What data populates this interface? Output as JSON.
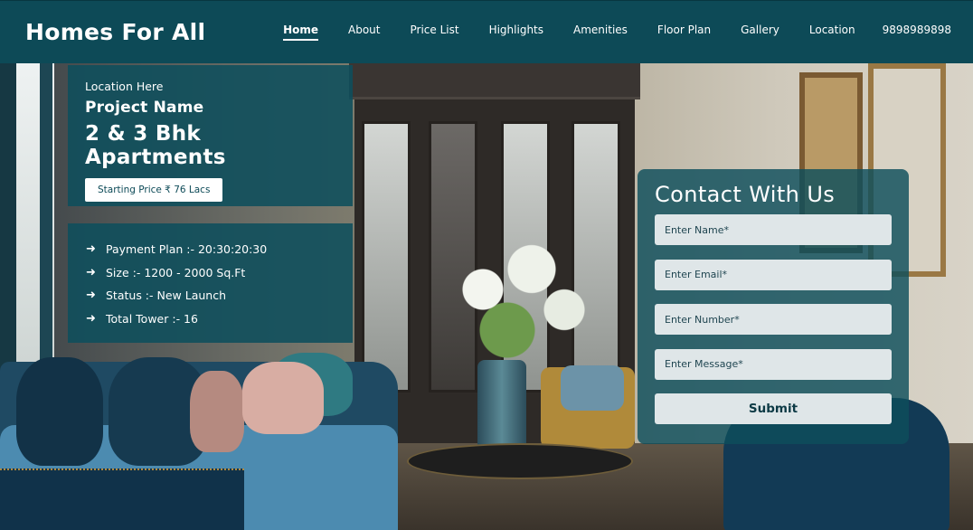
{
  "header": {
    "brand": "Homes For All",
    "nav": [
      "Home",
      "About",
      "Price List",
      "Highlights",
      "Amenities",
      "Floor Plan",
      "Gallery",
      "Location"
    ],
    "phone": "9898989898",
    "active": "Home"
  },
  "hero": {
    "location": "Location Here",
    "project_name": "Project Name",
    "apartment_type": "2 & 3 Bhk Apartments",
    "price_button": "Starting Price ₹ 76 Lacs",
    "features": [
      {
        "icon": "arrow-right-icon",
        "text": "Payment Plan :- 20:30:20:30"
      },
      {
        "icon": "arrow-right-icon",
        "text": "Size :-  1200 - 2000 Sq.Ft"
      },
      {
        "icon": "arrow-right-icon",
        "text": "Status :- New Launch"
      },
      {
        "icon": "arrow-right-icon",
        "text": "Total Tower :- 16"
      }
    ]
  },
  "contact": {
    "title": "Contact With Us",
    "name_placeholder": "Enter Name*",
    "email_placeholder": "Enter Email*",
    "number_placeholder": "Enter Number*",
    "message_placeholder": "Enter Message*",
    "submit_label": "Submit"
  },
  "colors": {
    "brand_teal": "#0d4a57",
    "field_bg": "#dfe6e8"
  }
}
